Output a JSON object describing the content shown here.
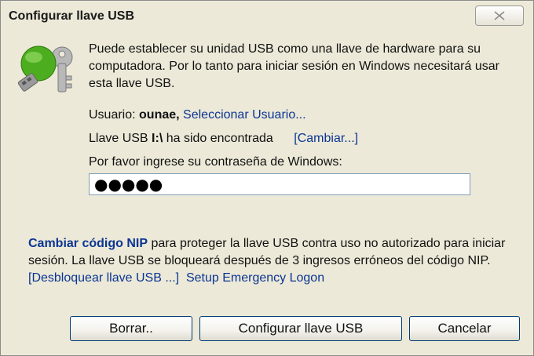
{
  "window": {
    "title": "Configurar llave USB"
  },
  "intro_text": "Puede establecer su unidad USB como una llave de hardware para su computadora. Por lo tanto para iniciar sesión en Windows necesitará usar esta llave USB.",
  "user": {
    "label": "Usuario:",
    "name": "ounae,",
    "select_link": "Seleccionar Usuario..."
  },
  "usb_key": {
    "prefix": "Llave USB",
    "drive": "I:\\",
    "status": "ha sido encontrada",
    "change_link": "[Cambiar...]"
  },
  "password": {
    "label": "Por favor ingrese su contraseña de Windows:",
    "value": "●●●●●"
  },
  "nip": {
    "link": "Cambiar código NIP",
    "text": " para proteger la llave USB contra uso no autorizado para iniciar sesión. La llave USB se bloqueará después de 3 ingresos erróneos del código NIP. ",
    "unlock_link": "[Desbloquear llave USB ...]",
    "emergency_link": "Setup Emergency Logon"
  },
  "buttons": {
    "clear": "Borrar..",
    "configure": "Configurar llave USB",
    "cancel": "Cancelar"
  },
  "icons": {
    "close": "close-icon",
    "usb": "usb-key-icon"
  },
  "colors": {
    "link": "#0b3593",
    "background": "#ECE9D8",
    "usb_green": "#4cae1f"
  }
}
